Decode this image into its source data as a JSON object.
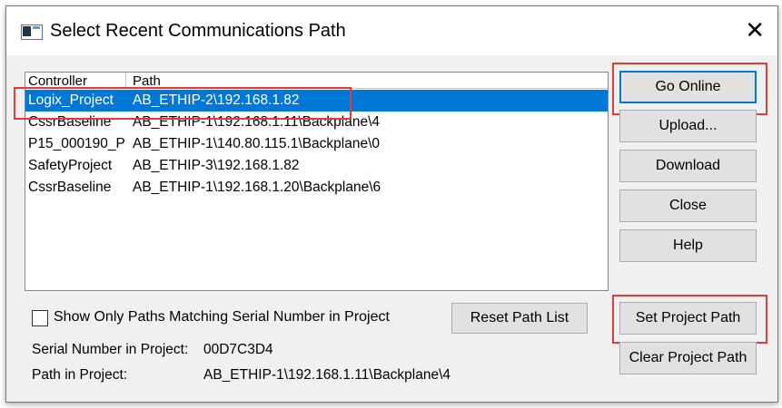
{
  "window": {
    "title": "Select Recent Communications Path",
    "close_symbol": "✕"
  },
  "list": {
    "columns": [
      "Controller",
      "Path"
    ],
    "rows": [
      {
        "controller": "Logix_Project",
        "path": "AB_ETHIP-2\\192.168.1.82",
        "selected": true
      },
      {
        "controller": "CssrBaseline",
        "path": "AB_ETHIP-1\\192.168.1.11\\Backplane\\4",
        "selected": false
      },
      {
        "controller": "P15_000190_P",
        "path": "AB_ETHIP-1\\140.80.115.1\\Backplane\\0",
        "selected": false
      },
      {
        "controller": "SafetyProject",
        "path": "AB_ETHIP-3\\192.168.1.82",
        "selected": false
      },
      {
        "controller": "CssrBaseline",
        "path": "AB_ETHIP-1\\192.168.1.20\\Backplane\\6",
        "selected": false
      }
    ]
  },
  "buttons": {
    "go_online": "Go Online",
    "upload": "Upload...",
    "download": "Download",
    "close": "Close",
    "help": "Help",
    "reset_path_list": "Reset Path List",
    "set_project_path": "Set Project Path",
    "clear_project_path": "Clear Project Path"
  },
  "checkbox": {
    "label": "Show Only Paths Matching Serial Number in Project",
    "checked": false
  },
  "info": {
    "serial_label": "Serial Number in Project:",
    "serial_value": "00D7C3D4",
    "path_label": "Path in Project:",
    "path_value": "AB_ETHIP-1\\192.168.1.11\\Backplane\\4"
  },
  "colors": {
    "selection": "#0078d7",
    "highlight_box": "#e63a3a",
    "dialog_bg": "#f0f0f0"
  }
}
